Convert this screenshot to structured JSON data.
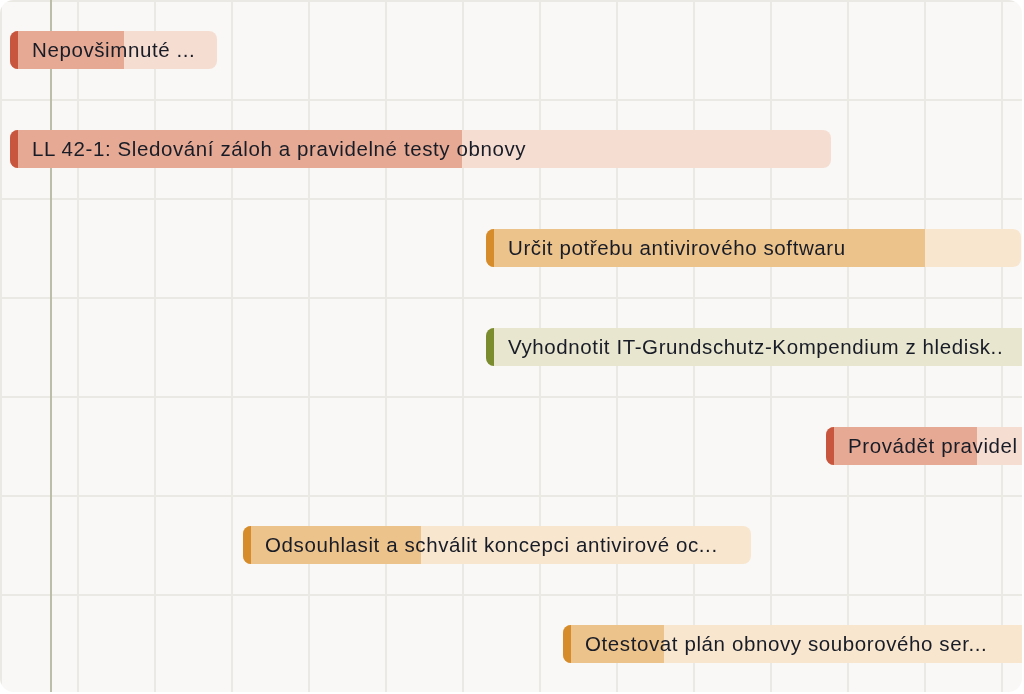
{
  "gantt": {
    "tasks": [
      {
        "label": "Nepovšimnuté ...",
        "color": "#c8553d",
        "level": 0.55
      },
      {
        "label": "LL 42-1: Sledování záloh a pravidelné testy obnovy",
        "color": "#c8553d",
        "level": 0.55
      },
      {
        "label": "Určit potřebu antivirového softwaru",
        "color": "#d68c2a",
        "level": 0.82
      },
      {
        "label": "Vyhodnotit IT-Grundschutz-Kompendium z hledisk..",
        "color": "#7a8c2e",
        "level": 0
      },
      {
        "label": "Provádět pravidel",
        "color": "#c8553d",
        "level": 0.77
      },
      {
        "label": "Odsouhlasit a schválit koncepci antivirové oc...",
        "color": "#d68c2a",
        "level": 0.35
      },
      {
        "label": "Otestovat plán obnovy souborového ser...",
        "color": "#d68c2a",
        "level": 0.22
      }
    ]
  }
}
